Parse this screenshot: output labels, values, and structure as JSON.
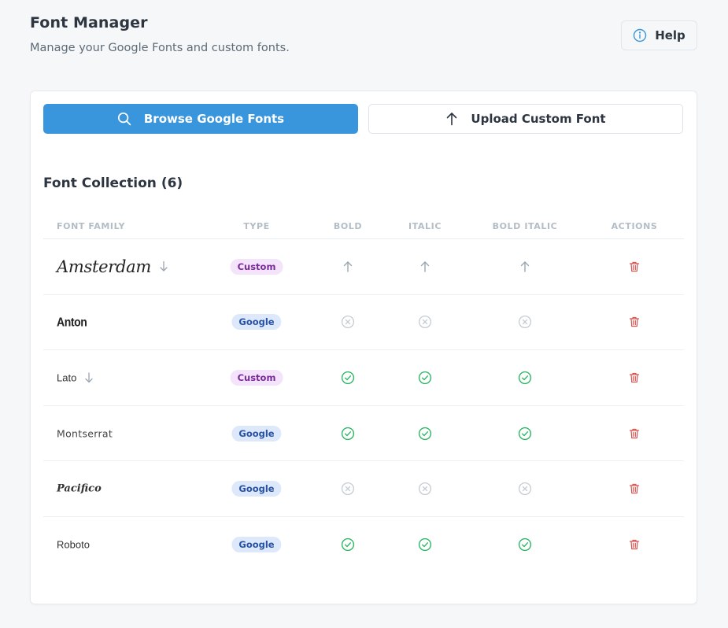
{
  "header": {
    "title": "Font Manager",
    "subtitle": "Manage your Google Fonts and custom fonts.",
    "help_label": "Help"
  },
  "actions": {
    "browse_label": "Browse Google Fonts",
    "upload_label": "Upload Custom Font"
  },
  "collection": {
    "title": "Font Collection (6)",
    "columns": {
      "font_family": "FONT FAMILY",
      "type": "TYPE",
      "bold": "BOLD",
      "italic": "ITALIC",
      "bold_italic": "BOLD ITALIC",
      "actions": "ACTIONS"
    },
    "rows": [
      {
        "name": "Amsterdam",
        "type": "Custom",
        "bold": "upload",
        "italic": "upload",
        "bold_italic": "upload",
        "has_download": true
      },
      {
        "name": "Anton",
        "type": "Google",
        "bold": "unavailable",
        "italic": "unavailable",
        "bold_italic": "unavailable",
        "has_download": false
      },
      {
        "name": "Lato",
        "type": "Custom",
        "bold": "available",
        "italic": "available",
        "bold_italic": "available",
        "has_download": true
      },
      {
        "name": "Montserrat",
        "type": "Google",
        "bold": "available",
        "italic": "available",
        "bold_italic": "available",
        "has_download": false
      },
      {
        "name": "Pacifico",
        "type": "Google",
        "bold": "unavailable",
        "italic": "unavailable",
        "bold_italic": "unavailable",
        "has_download": false
      },
      {
        "name": "Roboto",
        "type": "Google",
        "bold": "available",
        "italic": "available",
        "bold_italic": "available",
        "has_download": false
      }
    ]
  },
  "icons": {
    "help": "info-circle-icon",
    "browse": "search-icon",
    "upload": "arrow-up-icon",
    "download": "arrow-down-icon",
    "available": "check-circle-icon",
    "unavailable": "x-circle-icon",
    "delete": "trash-icon"
  },
  "colors": {
    "primary": "#3a96dc",
    "available": "#2fb765",
    "unavailable": "#c5ccd3",
    "delete": "#d9534f",
    "custom_badge_bg": "#f3e4fb",
    "custom_badge_text": "#7a2a9b",
    "google_badge_bg": "#dde9fb",
    "google_badge_text": "#2751a3"
  }
}
